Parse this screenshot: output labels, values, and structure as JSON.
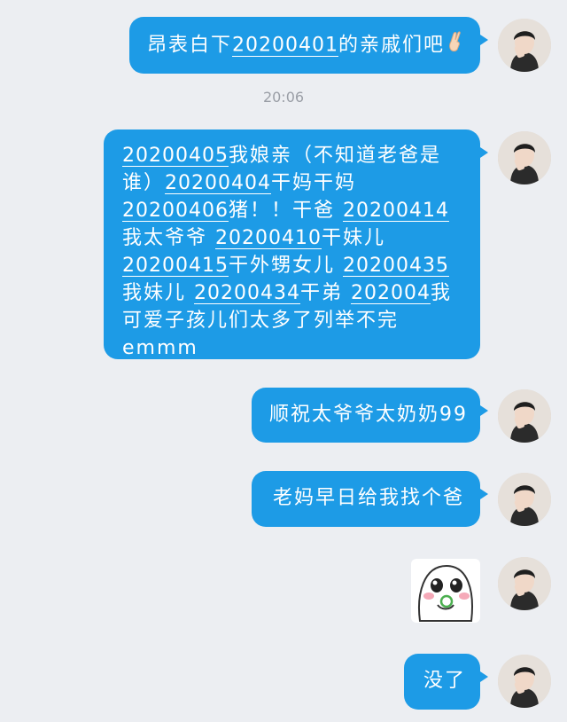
{
  "chat": {
    "timestamp": "20:06",
    "messages": [
      {
        "segments": [
          "昂表白下",
          "20200401",
          "的亲戚们吧"
        ],
        "emoji": "crossed-fingers"
      },
      {
        "segments": [
          "20200405",
          "我娘亲（不知道老爸是谁）",
          "20200404",
          "干妈干妈 ",
          "20200406",
          "猪！！干爸 ",
          "20200414",
          "我太爷爷 ",
          "20200410",
          "干妹儿 ",
          "20200415",
          "干外甥女儿 ",
          "20200435",
          "我妹儿 ",
          "20200434",
          "干弟 ",
          "202004",
          "我可爱子孩儿们太多了列举不完emmm"
        ]
      },
      {
        "text": "顺祝太爷爷太奶奶99"
      },
      {
        "text": "老妈早日给我找个爸"
      },
      {
        "sticker": "crying-blob-sticker"
      },
      {
        "text": "没了"
      }
    ]
  },
  "colors": {
    "bubble": "#1d9be6",
    "background": "#eceef2",
    "timestamp": "#9a9ea6"
  }
}
